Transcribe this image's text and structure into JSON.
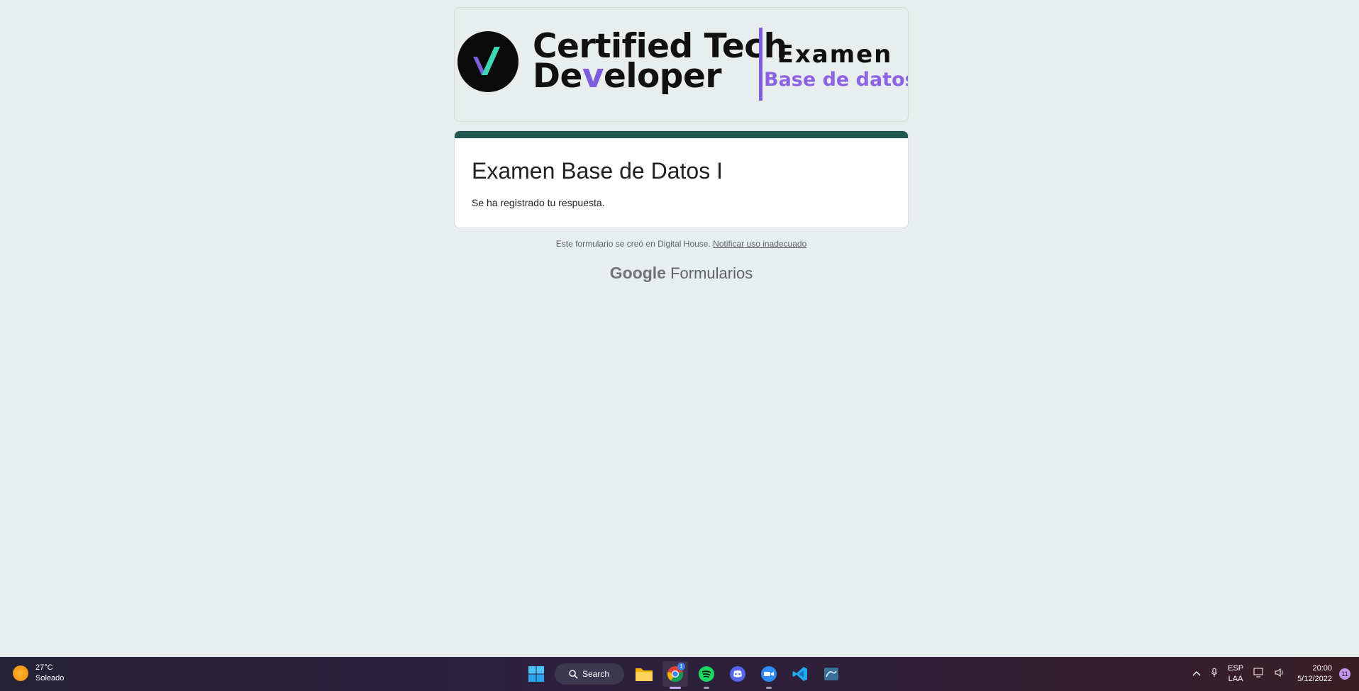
{
  "banner": {
    "title_line1": "Certified Tech",
    "title_line2_a": "De",
    "title_line2_v": "v",
    "title_line2_b": "eloper",
    "exam_label": "Examen",
    "exam_subject": "Base de datos"
  },
  "form": {
    "title": "Examen Base de Datos I",
    "confirmation": "Se ha registrado tu respuesta."
  },
  "footer": {
    "note": "Este formulario se creó en Digital House.",
    "report_link": "Notificar uso inadecuado",
    "brand_google": "Google",
    "brand_forms": "Formularios"
  },
  "taskbar": {
    "weather_temp": "27°C",
    "weather_desc": "Soleado",
    "search_label": "Search",
    "lang_top": "ESP",
    "lang_bottom": "LAA",
    "time": "20:00",
    "date": "5/12/2022",
    "notification_count": "11",
    "chrome_badge": "1",
    "apps": [
      "start-icon",
      "search-icon",
      "file-explorer-icon",
      "chrome-icon",
      "spotify-icon",
      "discord-icon",
      "zoom-icon",
      "vscode-icon",
      "mysql-workbench-icon"
    ]
  },
  "colors": {
    "accent_purple": "#7d5ce0",
    "form_header": "#1f5650",
    "background": "#e8eeed"
  }
}
